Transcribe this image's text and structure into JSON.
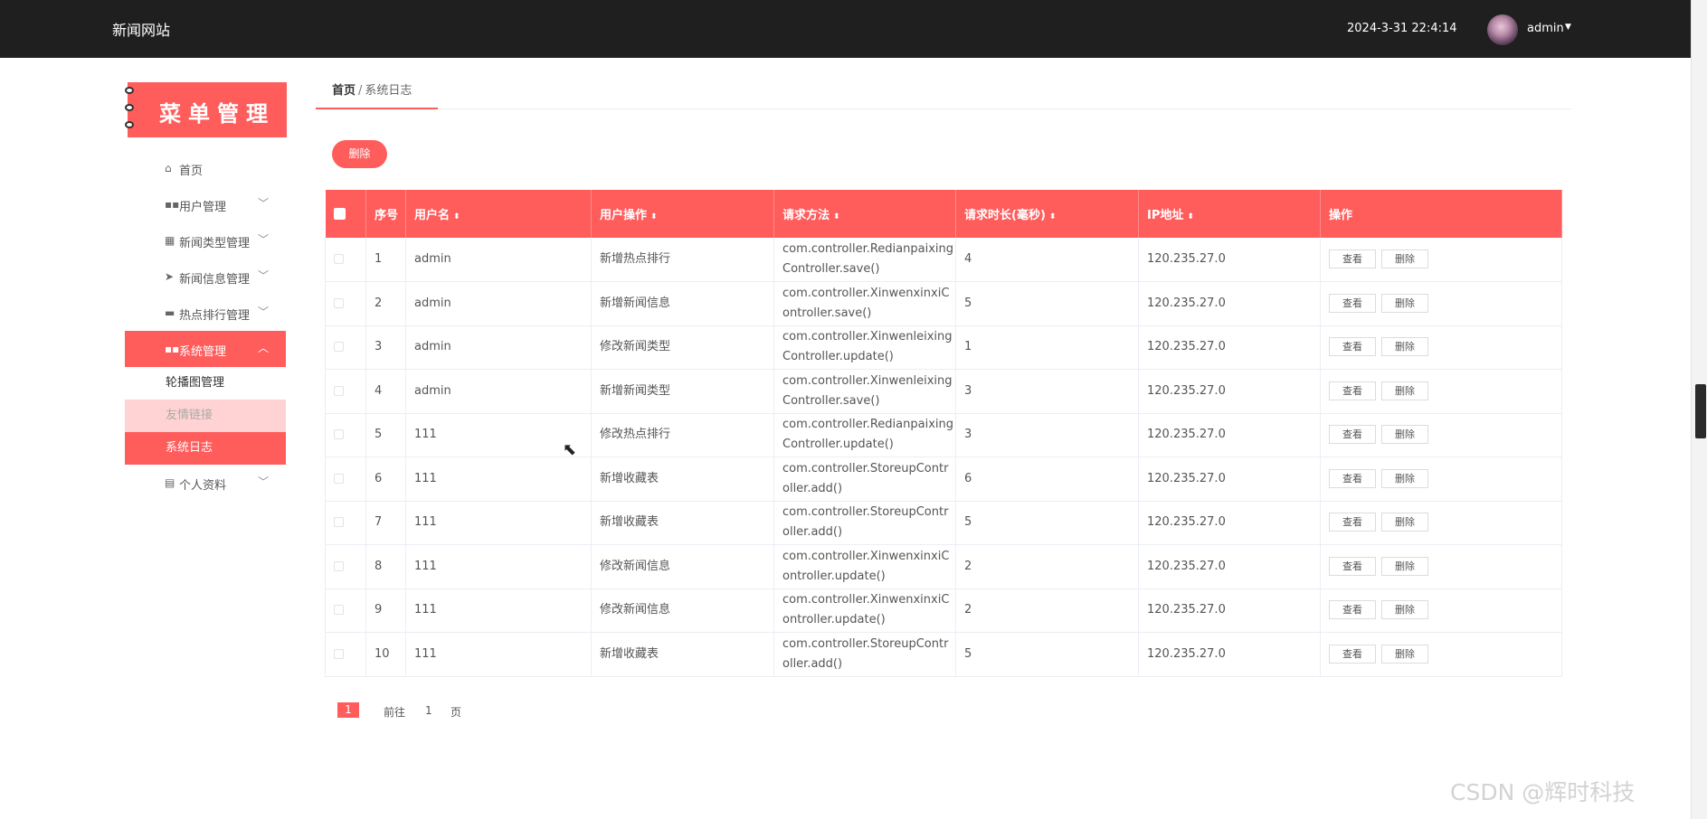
{
  "header": {
    "site_title": "新闻网站",
    "datetime": "2024-3-31 22:4:14",
    "user": "admin"
  },
  "sidebar": {
    "banner": "菜单管理",
    "items": [
      {
        "label": "首页",
        "icon": "home-icon"
      },
      {
        "label": "用户管理",
        "icon": "grid-icon"
      },
      {
        "label": "新闻类型管理",
        "icon": "grid9-icon"
      },
      {
        "label": "新闻信息管理",
        "icon": "send-icon"
      },
      {
        "label": "热点排行管理",
        "icon": "print-icon"
      },
      {
        "label": "系统管理",
        "icon": "grid-icon"
      }
    ],
    "subitems": [
      "轮播图管理",
      "友情链接",
      "系统日志"
    ],
    "profile": {
      "label": "个人资料",
      "icon": "folder-icon"
    }
  },
  "breadcrumb": {
    "home": "首页",
    "sep": "/",
    "current": "系统日志"
  },
  "toolbar": {
    "delete_label": "删除"
  },
  "table": {
    "headers": [
      "序号",
      "用户名",
      "用户操作",
      "请求方法",
      "请求时长(毫秒)",
      "IP地址",
      "操作"
    ],
    "rows": [
      {
        "idx": "1",
        "user": "admin",
        "op": "新增热点排行",
        "method": "com.controller.RedianpaixingController.save()",
        "dur": "4",
        "ip": "120.235.27.0"
      },
      {
        "idx": "2",
        "user": "admin",
        "op": "新增新闻信息",
        "method": "com.controller.XinwenxinxiController.save()",
        "dur": "5",
        "ip": "120.235.27.0"
      },
      {
        "idx": "3",
        "user": "admin",
        "op": "修改新闻类型",
        "method": "com.controller.XinwenleixingController.update()",
        "dur": "1",
        "ip": "120.235.27.0"
      },
      {
        "idx": "4",
        "user": "admin",
        "op": "新增新闻类型",
        "method": "com.controller.XinwenleixingController.save()",
        "dur": "3",
        "ip": "120.235.27.0"
      },
      {
        "idx": "5",
        "user": "111",
        "op": "修改热点排行",
        "method": "com.controller.RedianpaixingController.update()",
        "dur": "3",
        "ip": "120.235.27.0"
      },
      {
        "idx": "6",
        "user": "111",
        "op": "新增收藏表",
        "method": "com.controller.StoreupController.add()",
        "dur": "6",
        "ip": "120.235.27.0"
      },
      {
        "idx": "7",
        "user": "111",
        "op": "新增收藏表",
        "method": "com.controller.StoreupController.add()",
        "dur": "5",
        "ip": "120.235.27.0"
      },
      {
        "idx": "8",
        "user": "111",
        "op": "修改新闻信息",
        "method": "com.controller.XinwenxinxiController.update()",
        "dur": "2",
        "ip": "120.235.27.0"
      },
      {
        "idx": "9",
        "user": "111",
        "op": "修改新闻信息",
        "method": "com.controller.XinwenxinxiController.update()",
        "dur": "2",
        "ip": "120.235.27.0"
      },
      {
        "idx": "10",
        "user": "111",
        "op": "新增收藏表",
        "method": "com.controller.StoreupController.add()",
        "dur": "5",
        "ip": "120.235.27.0"
      }
    ],
    "view_label": "查看",
    "delete_label": "删除"
  },
  "pagination": {
    "current": "1",
    "goto": "前往",
    "page_input": "1",
    "page_unit": "页"
  },
  "watermark": "CSDN @辉时科技",
  "colors": {
    "accent": "#ff5c5c",
    "topbar": "#1f1f1f",
    "hover": "#ffd3d3"
  }
}
